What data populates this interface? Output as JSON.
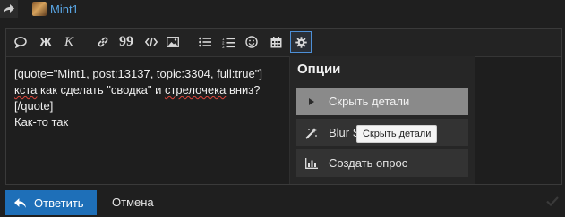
{
  "reply_header": {
    "username": "Mint1"
  },
  "toolbar": {
    "buttons": [
      {
        "name": "quote-button",
        "icon": "speech-bubble-icon"
      },
      {
        "name": "bold-button",
        "label": "Ж"
      },
      {
        "name": "italic-button",
        "label": "К"
      },
      {
        "name": "link-button",
        "icon": "link-icon"
      },
      {
        "name": "blockquote-button",
        "label": "99"
      },
      {
        "name": "code-button",
        "icon": "code-icon"
      },
      {
        "name": "image-button",
        "icon": "image-icon"
      },
      {
        "name": "bullet-list-button",
        "icon": "bullet-list-icon"
      },
      {
        "name": "numbered-list-button",
        "icon": "numbered-list-icon"
      },
      {
        "name": "emoji-button",
        "icon": "smiley-icon"
      },
      {
        "name": "date-button",
        "icon": "calendar-icon"
      },
      {
        "name": "options-button",
        "icon": "gear-icon"
      }
    ]
  },
  "editor": {
    "lines": [
      "[quote=\"Mint1, post:13137, topic:3304, full:true\"]",
      "кста как сделать \"сводка\" и стрелочека вниз?",
      "[/quote]",
      "Как-то так"
    ],
    "misspelled": [
      "кста",
      "стрелочека"
    ]
  },
  "options_menu": {
    "title": "Опции",
    "items": [
      {
        "label": "Скрыть детали",
        "icon": "caret-right-icon",
        "highlighted": true
      },
      {
        "label": "Blur S",
        "icon": "magic-wand-icon",
        "highlighted": false
      },
      {
        "label": "Создать опрос",
        "icon": "bar-chart-icon",
        "highlighted": false
      }
    ]
  },
  "tooltip": {
    "text": "Скрыть детали"
  },
  "footer": {
    "submit_label": "Ответить",
    "cancel_label": "Отмена"
  },
  "colors": {
    "accent": "#1e6fb8",
    "link": "#5aa7e6",
    "background": "#1f1f1f",
    "highlight": "#8a8a8a"
  }
}
